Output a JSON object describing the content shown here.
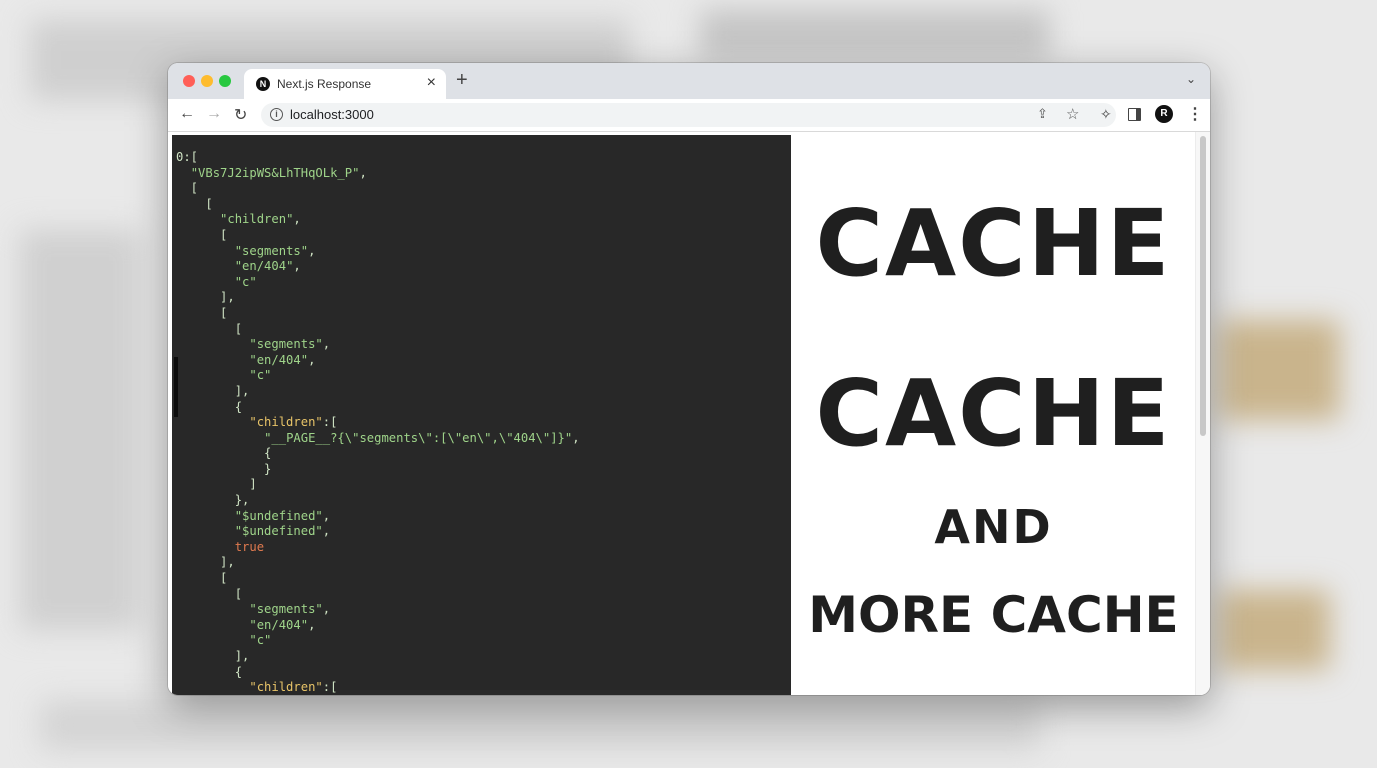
{
  "browser": {
    "tab_title": "Next.js Response",
    "tab_favicon": "N",
    "close_glyph": "×",
    "new_tab_glyph": "+",
    "chevron_glyph": "⌄",
    "url": "localhost:3000",
    "profile_initial": "R"
  },
  "icons": {
    "back": "back-arrow-icon",
    "forward": "forward-arrow-icon",
    "reload": "reload-icon",
    "info": "info-icon",
    "share": "share-icon",
    "star": "star-icon",
    "extensions": "puzzle-icon",
    "side_panel": "side-panel-icon",
    "menu": "kebab-menu-icon"
  },
  "code_lines": [
    "0:[",
    "  \"VBs7J2ipWS&LhTHqOLk_P\",",
    "  [",
    "    [",
    "      \"children\",",
    "      [",
    "        \"segments\",",
    "        \"en/404\",",
    "        \"c\"",
    "      ],",
    "      [",
    "        [",
    "          \"segments\",",
    "          \"en/404\",",
    "          \"c\"",
    "        ],",
    "        {",
    "          \"children\":[",
    "            \"__PAGE__?{\\\"segments\\\":[\\\"en\\\",\\\"404\\\"]}\",",
    "            {",
    "            }",
    "          ]",
    "        },",
    "        \"$undefined\",",
    "        \"$undefined\",",
    "        true",
    "      ],",
    "      [",
    "        [",
    "          \"segments\",",
    "          \"en/404\",",
    "          \"c\"",
    "        ],",
    "        {",
    "          \"children\":["
  ],
  "headline": {
    "line1": "CACHE",
    "line2": "CACHE",
    "line3": "AND",
    "line4": "MORE CACHE"
  },
  "colors": {
    "code_bg": "#282828",
    "string": "#9fd48a",
    "key": "#e8c468",
    "keyword": "#e07a4f"
  }
}
